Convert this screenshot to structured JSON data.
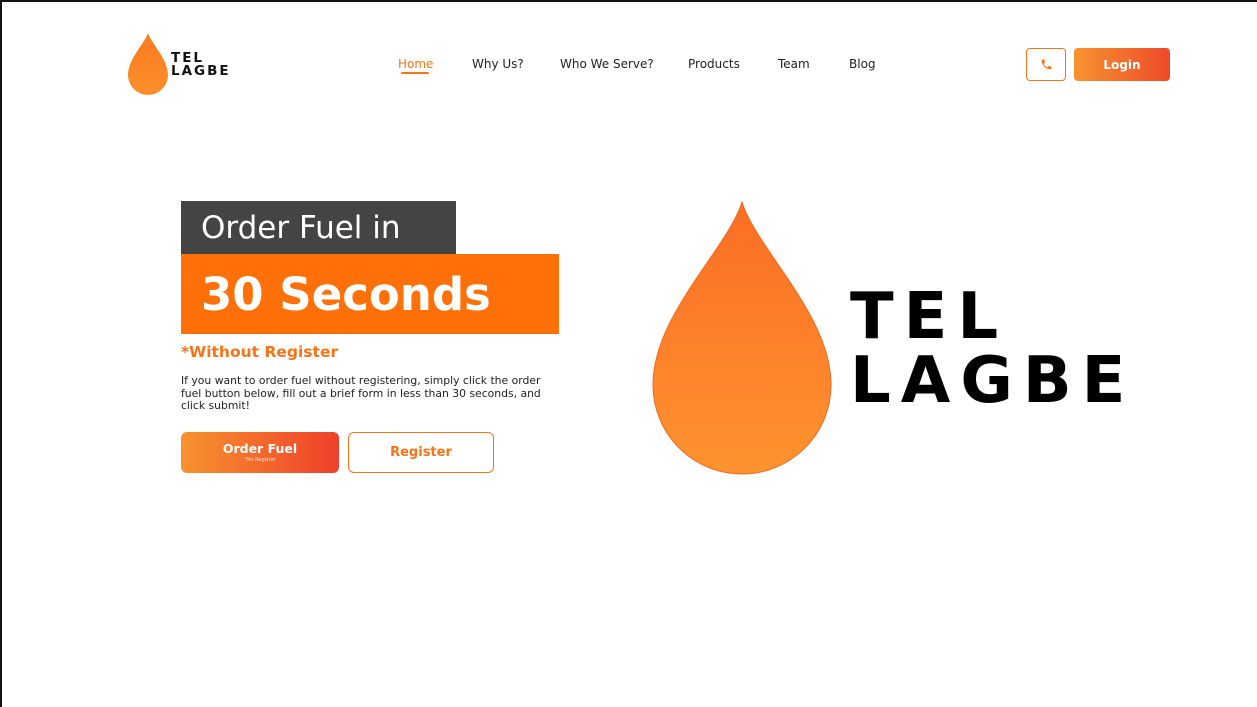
{
  "brand": {
    "line1": "TEL",
    "line2": "LAGBE",
    "accent": "#f97316",
    "dark": "#444444"
  },
  "nav": {
    "items": [
      {
        "label": "Home",
        "active": true
      },
      {
        "label": "Why Us?"
      },
      {
        "label": "Who We Serve?"
      },
      {
        "label": "Products"
      },
      {
        "label": "Team"
      },
      {
        "label": "Blog"
      }
    ]
  },
  "header": {
    "phone_icon": "phone-icon",
    "login_label": "Login"
  },
  "hero": {
    "headline_top": "Order Fuel in",
    "headline_bottom": "30 Seconds",
    "subhead": "*Without Register",
    "description": "If you want to order fuel without registering, simply click the order fuel button below, fill out a brief form in less than 30 seconds, and click submit!",
    "order_button": "Order Fuel",
    "order_button_sub": "*No Register",
    "register_button": "Register"
  }
}
